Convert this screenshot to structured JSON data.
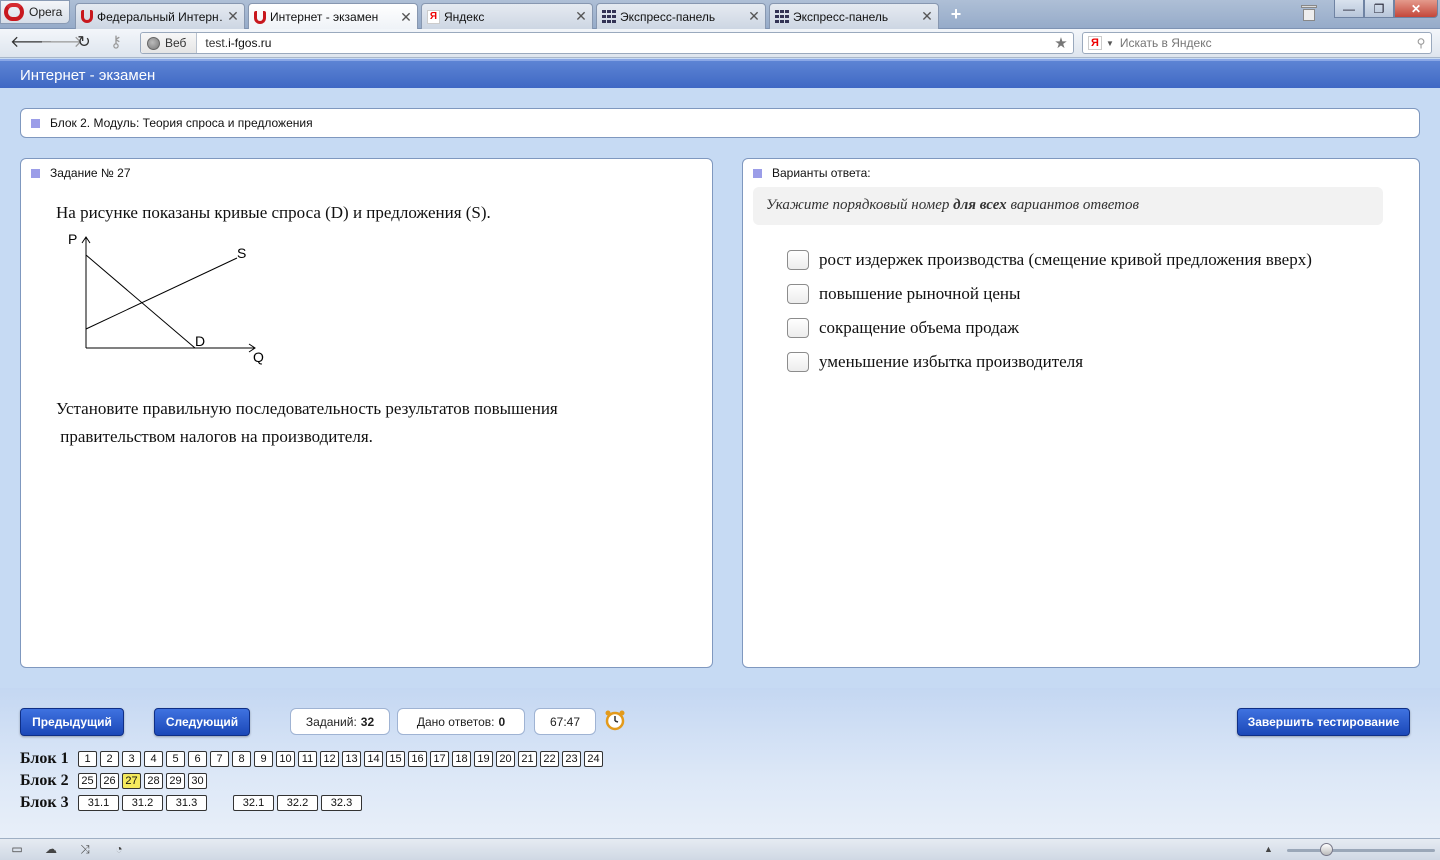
{
  "browser": {
    "menu_label": "Opera",
    "tabs": [
      {
        "title": "Федеральный Интерн…",
        "icon": "opera-icon"
      },
      {
        "title": "Интернет - экзамен",
        "icon": "opera-icon"
      },
      {
        "title": "Яндекс",
        "icon": "yandex-icon"
      },
      {
        "title": "Экспресс-панель",
        "icon": "speed-dial-icon"
      },
      {
        "title": "Экспресс-панель",
        "icon": "speed-dial-icon"
      }
    ],
    "active_tab": 1,
    "address_prefix": "Веб",
    "url_host": "test.",
    "url_domain": "i-fgos.ru",
    "search_placeholder": "Искать в Яндекс",
    "yandex_glyph": "Я"
  },
  "header": {
    "title": "Интернет - экзамен"
  },
  "block_panel": {
    "title": "Блок 2. Модуль: Теория спроса и предложения"
  },
  "task": {
    "title": "Задание № 27",
    "text1": "На рисунке показаны кривые спроса (D) и предложения (S).",
    "graph_labels": {
      "p": "P",
      "q": "Q",
      "s": "S",
      "d": "D"
    },
    "text2_line1": "Установите правильную последовательность результатов повышения",
    "text2_line2": " правительством налогов на производителя."
  },
  "answers": {
    "title": "Варианты ответа:",
    "instruction_pre": "Укажите порядковый номер ",
    "instruction_bold": "для всех",
    "instruction_post": " вариантов ответов",
    "options": [
      "рост издержек производства (смещение кривой предложения вверх)",
      "повышение рыночной цены",
      "сокращение объема продаж",
      "уменьшение избытка производителя"
    ]
  },
  "footer": {
    "prev_label": "Предыдущий",
    "next_label": "Следующий",
    "finish_label": "Завершить тестирование",
    "tasks_label": "Заданий:",
    "tasks_count": "32",
    "answered_label": "Дано ответов:",
    "answered_count": "0",
    "timer": "67:47",
    "current_task": "27",
    "block1_label": "Блок 1",
    "block2_label": "Блок 2",
    "block3_label": "Блок 3",
    "block1": [
      "1",
      "2",
      "3",
      "4",
      "5",
      "6",
      "7",
      "8",
      "9",
      "10",
      "11",
      "12",
      "13",
      "14",
      "15",
      "16",
      "17",
      "18",
      "19",
      "20",
      "21",
      "22",
      "23",
      "24"
    ],
    "block2": [
      "25",
      "26",
      "27",
      "28",
      "29",
      "30"
    ],
    "block3a": [
      "31.1",
      "31.2",
      "31.3"
    ],
    "block3b": [
      "32.1",
      "32.2",
      "32.3"
    ]
  },
  "colors": {
    "accent": "#2a56c6",
    "header": "#4a72c9",
    "current_cell": "#f5ea5d",
    "bullet": "#9b9de8"
  }
}
